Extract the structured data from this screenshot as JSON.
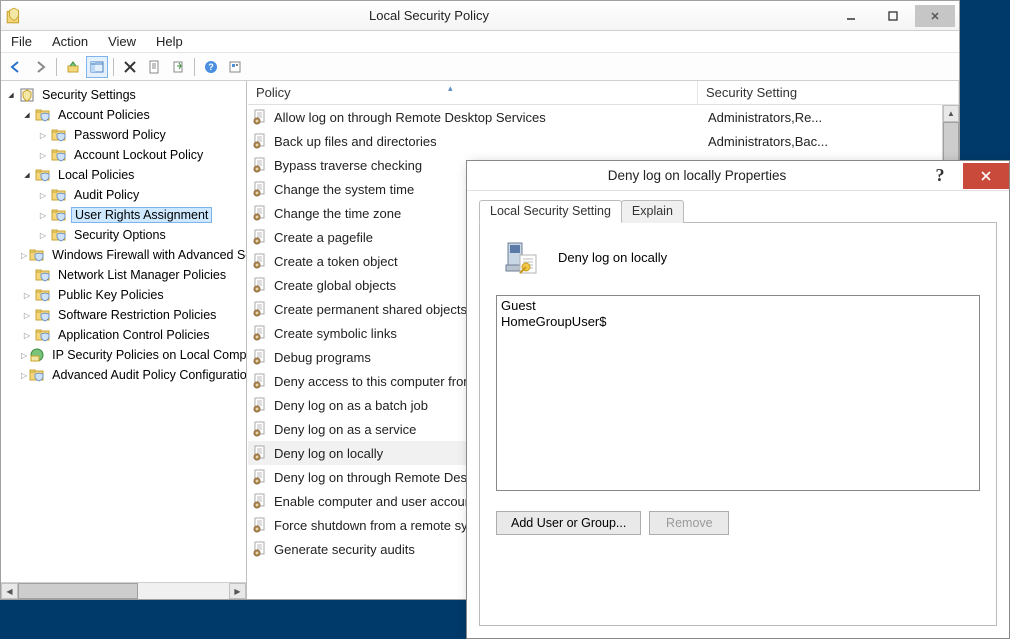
{
  "window": {
    "title": "Local Security Policy",
    "menu": [
      "File",
      "Action",
      "View",
      "Help"
    ]
  },
  "tree": {
    "root": "Security Settings",
    "nodes": [
      {
        "label": "Account Policies",
        "level": 1,
        "exp": "open",
        "sel": false,
        "children": [
          {
            "label": "Password Policy",
            "level": 2,
            "exp": "closed"
          },
          {
            "label": "Account Lockout Policy",
            "level": 2,
            "exp": "closed"
          }
        ]
      },
      {
        "label": "Local Policies",
        "level": 1,
        "exp": "open",
        "children": [
          {
            "label": "Audit Policy",
            "level": 2,
            "exp": "closed"
          },
          {
            "label": "User Rights Assignment",
            "level": 2,
            "exp": "closed",
            "sel": true
          },
          {
            "label": "Security Options",
            "level": 2,
            "exp": "closed"
          }
        ]
      },
      {
        "label": "Windows Firewall with Advanced Security",
        "level": 1,
        "exp": "closed"
      },
      {
        "label": "Network List Manager Policies",
        "level": 1,
        "exp": "none"
      },
      {
        "label": "Public Key Policies",
        "level": 1,
        "exp": "closed"
      },
      {
        "label": "Software Restriction Policies",
        "level": 1,
        "exp": "closed"
      },
      {
        "label": "Application Control Policies",
        "level": 1,
        "exp": "closed"
      },
      {
        "label": "IP Security Policies on Local Computer",
        "level": 1,
        "exp": "closed",
        "icon": "ip"
      },
      {
        "label": "Advanced Audit Policy Configuration",
        "level": 1,
        "exp": "closed"
      }
    ]
  },
  "list": {
    "columns": {
      "policy": "Policy",
      "setting": "Security Setting"
    },
    "rows": [
      {
        "name": "Allow log on through Remote Desktop Services",
        "val": "Administrators,Re..."
      },
      {
        "name": "Back up files and directories",
        "val": "Administrators,Bac..."
      },
      {
        "name": "Bypass traverse checking",
        "val": ""
      },
      {
        "name": "Change the system time",
        "val": ""
      },
      {
        "name": "Change the time zone",
        "val": ""
      },
      {
        "name": "Create a pagefile",
        "val": ""
      },
      {
        "name": "Create a token object",
        "val": ""
      },
      {
        "name": "Create global objects",
        "val": ""
      },
      {
        "name": "Create permanent shared objects",
        "val": ""
      },
      {
        "name": "Create symbolic links",
        "val": ""
      },
      {
        "name": "Debug programs",
        "val": ""
      },
      {
        "name": "Deny access to this computer from the network",
        "val": ""
      },
      {
        "name": "Deny log on as a batch job",
        "val": ""
      },
      {
        "name": "Deny log on as a service",
        "val": ""
      },
      {
        "name": "Deny log on locally",
        "val": "",
        "sel": true
      },
      {
        "name": "Deny log on through Remote Desktop Services",
        "val": ""
      },
      {
        "name": "Enable computer and user accounts to be trusted for delegation",
        "val": ""
      },
      {
        "name": "Force shutdown from a remote system",
        "val": ""
      },
      {
        "name": "Generate security audits",
        "val": ""
      }
    ]
  },
  "dialog": {
    "title": "Deny log on locally Properties",
    "tabs": [
      "Local Security Setting",
      "Explain"
    ],
    "policy_name": "Deny log on locally",
    "users": [
      "Guest",
      "HomeGroupUser$"
    ],
    "buttons": {
      "add": "Add User or Group...",
      "remove": "Remove"
    }
  }
}
